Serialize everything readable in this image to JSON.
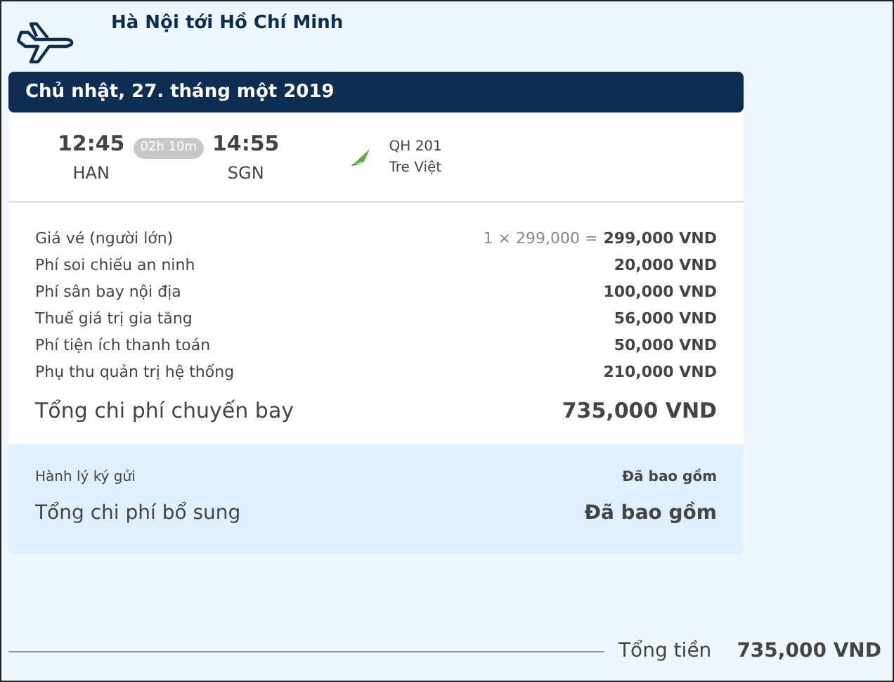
{
  "route": "Hà Nội tới Hồ Chí Minh",
  "date": "Chủ nhật, 27. tháng một 2019",
  "flight": {
    "depart_time": "12:45",
    "depart_code": "HAN",
    "duration": "02h 10m",
    "arrive_time": "14:55",
    "arrive_code": "SGN",
    "flight_no": "QH 201",
    "airline": "Tre Việt"
  },
  "fees": [
    {
      "label": "Giá vé (người lớn)",
      "calc": "1 × 299,000 =",
      "amount": "299,000 VND"
    },
    {
      "label": "Phí soi chiếu an ninh",
      "amount": "20,000 VND"
    },
    {
      "label": "Phí sân bay nội địa",
      "amount": "100,000 VND"
    },
    {
      "label": "Thuế giá trị gia tăng",
      "amount": "56,000 VND"
    },
    {
      "label": "Phí tiện ích thanh toán",
      "amount": "50,000 VND"
    },
    {
      "label": "Phụ thu quản trị hệ thống",
      "amount": "210,000 VND"
    }
  ],
  "flight_total": {
    "label": "Tổng chi phí chuyến bay",
    "amount": "735,000 VND"
  },
  "extras": [
    {
      "label": "Hành lý ký gửi",
      "amount": "Đã bao gồm"
    }
  ],
  "extras_total": {
    "label": "Tổng chi phí bổ sung",
    "amount": "Đã bao gồm"
  },
  "grand_total": {
    "label": "Tổng tiền",
    "amount": "735,000 VND"
  }
}
